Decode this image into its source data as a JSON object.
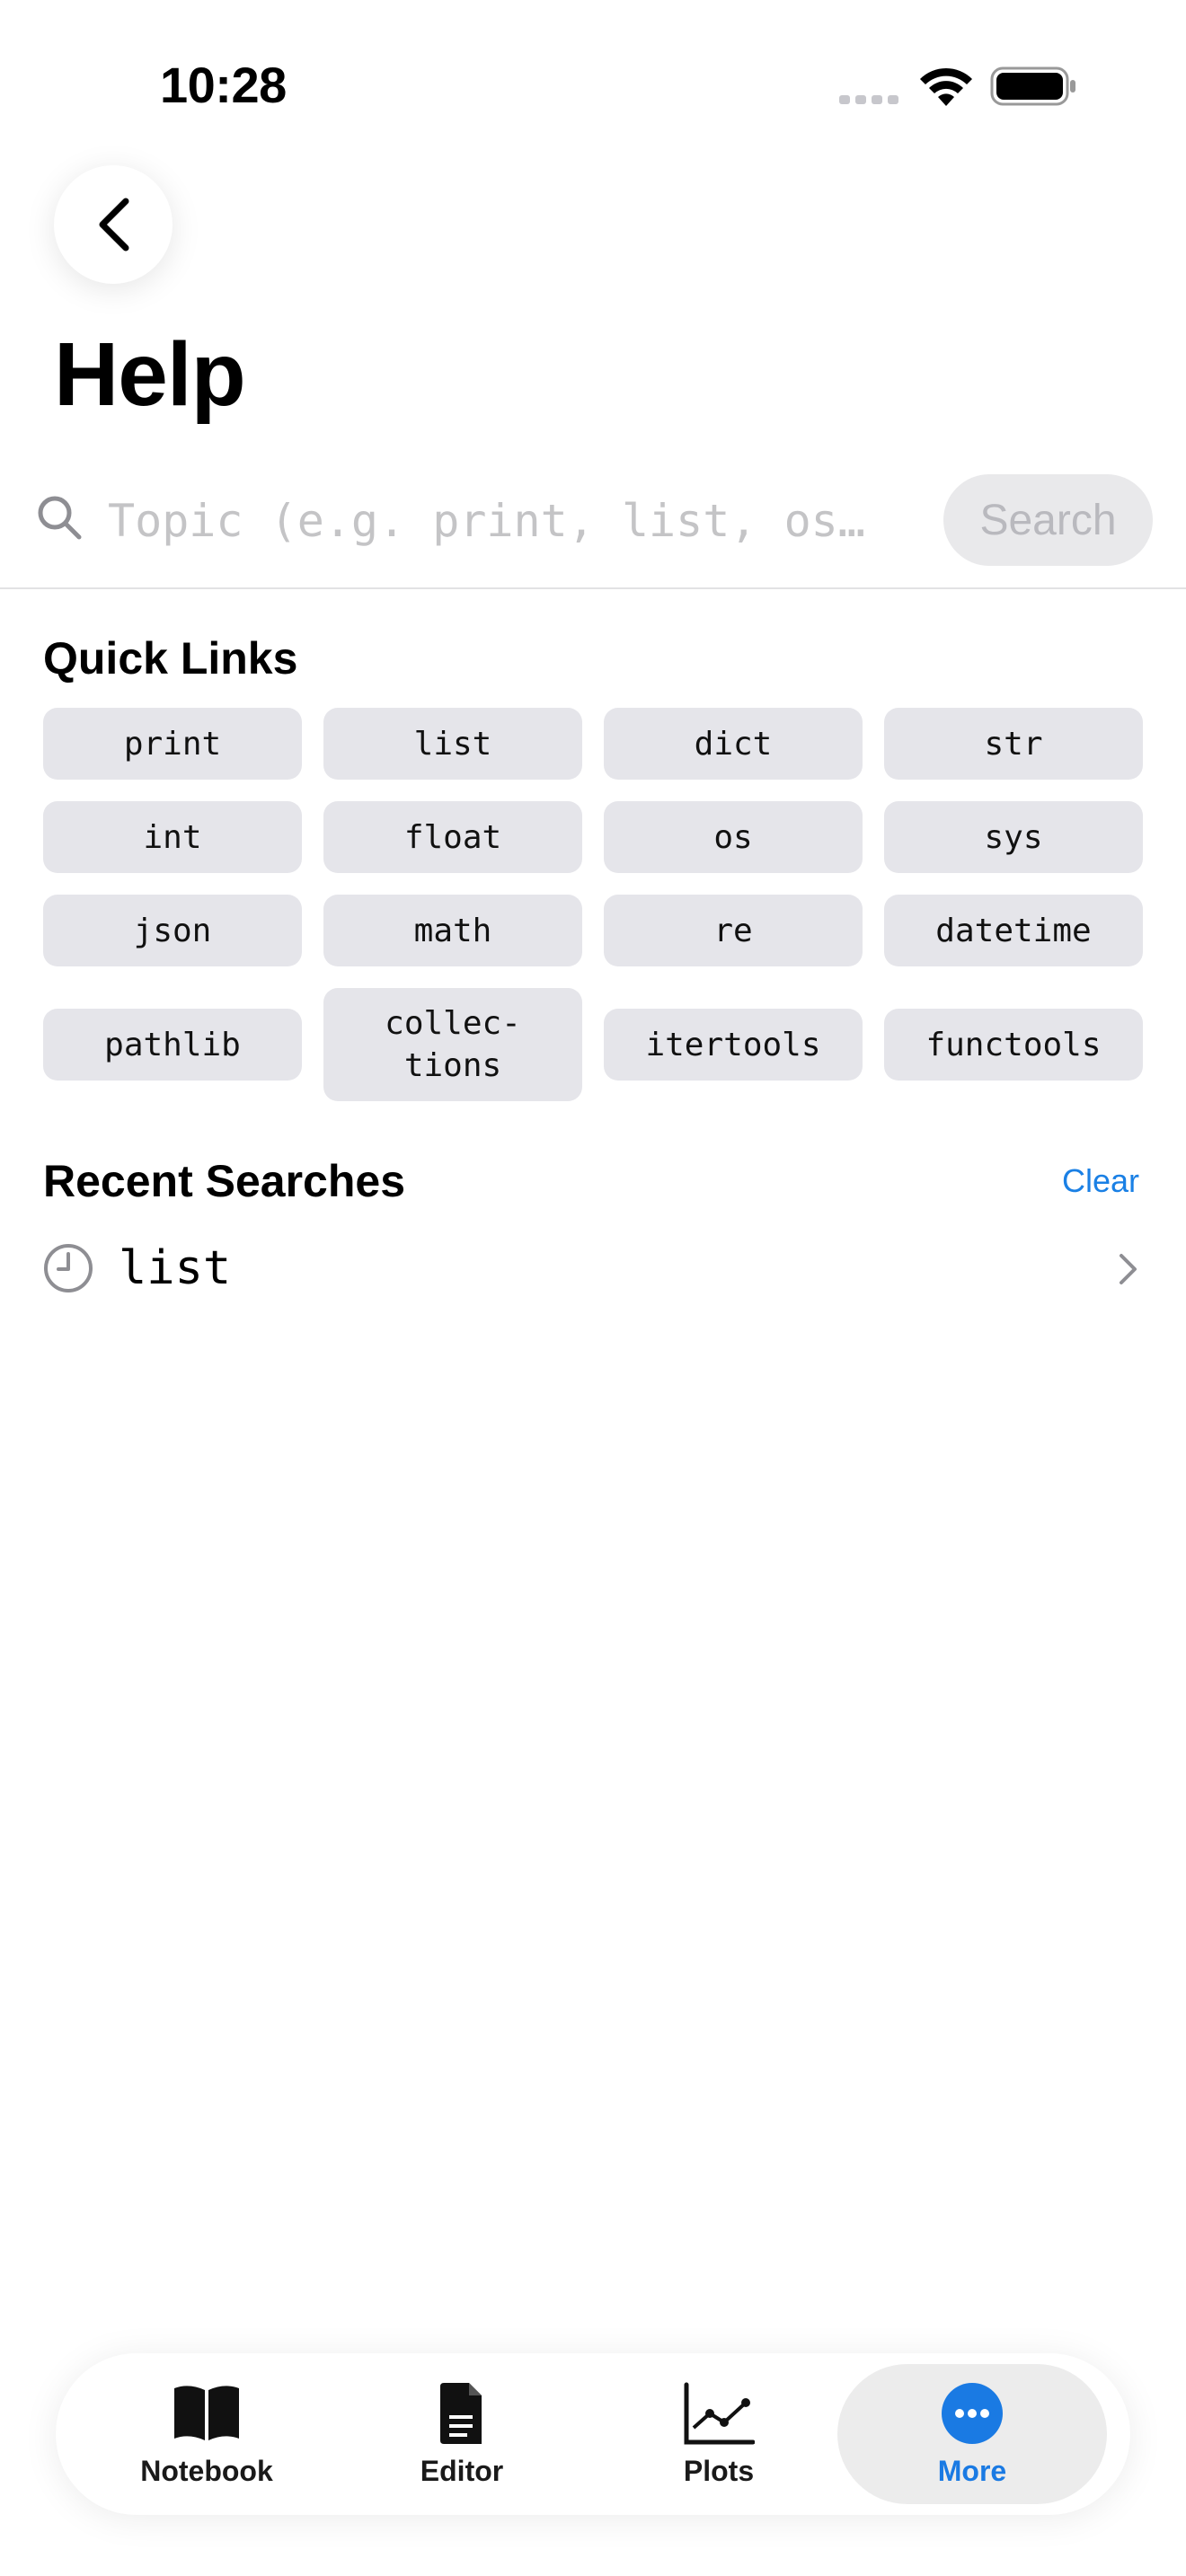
{
  "status": {
    "time": "10:28"
  },
  "header": {
    "title": "Help",
    "back_icon": "chevron-left-icon"
  },
  "search": {
    "placeholder": "Topic (e.g. print, list, os…",
    "value": "",
    "button_label": "Search"
  },
  "quick_links": {
    "title": "Quick Links",
    "items": [
      "print",
      "list",
      "dict",
      "str",
      "int",
      "float",
      "os",
      "sys",
      "json",
      "math",
      "re",
      "datetime",
      "pathlib",
      "collec-\ntions",
      "itertools",
      "functools"
    ]
  },
  "recent": {
    "title": "Recent Searches",
    "clear_label": "Clear",
    "items": [
      "list"
    ]
  },
  "tabs": [
    {
      "label": "Notebook",
      "icon": "book-icon"
    },
    {
      "label": "Editor",
      "icon": "document-icon"
    },
    {
      "label": "Plots",
      "icon": "chart-icon"
    },
    {
      "label": "More",
      "icon": "more-icon"
    }
  ],
  "colors": {
    "accent": "#1a7ae3",
    "chip_bg": "#e5e5ea"
  }
}
